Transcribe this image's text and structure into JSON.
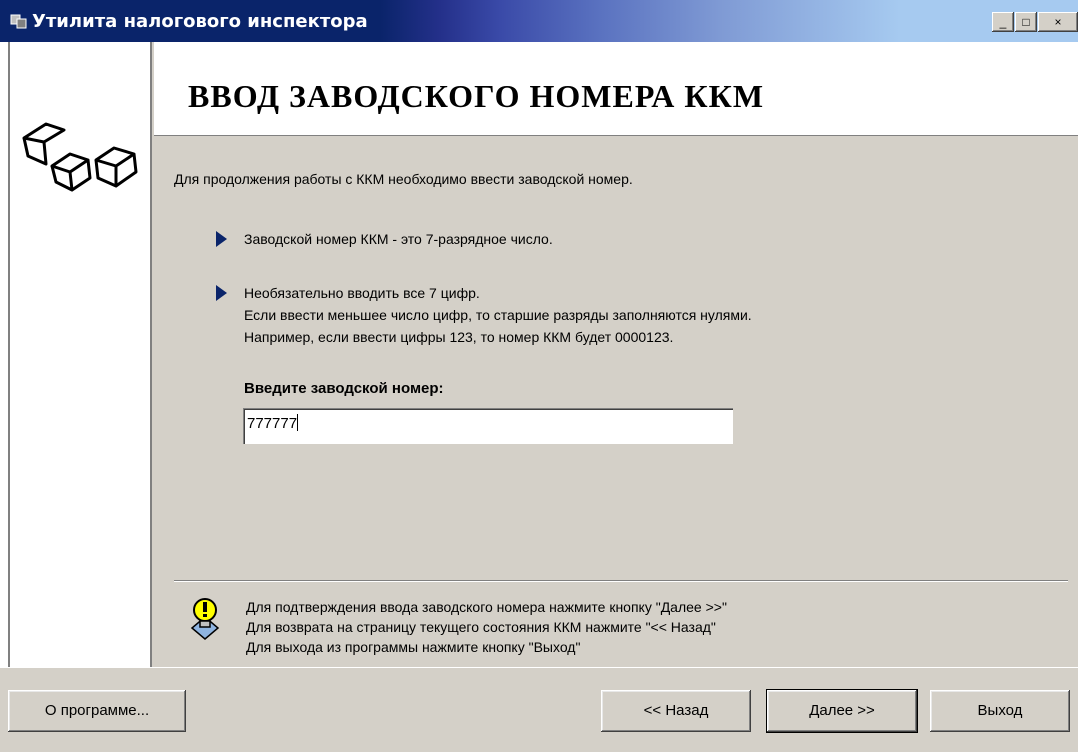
{
  "window": {
    "title": "Утилита налогового инспектора",
    "controls": {
      "minimize": "_",
      "maximize": "□",
      "close": "×"
    }
  },
  "header": {
    "title": "ВВОД ЗАВОДСКОГО НОМЕРА ККМ"
  },
  "content": {
    "intro": "Для продолжения работы с ККМ необходимо ввести заводской номер.",
    "bullets": [
      {
        "lines": [
          "Заводской номер ККМ - это 7-разрядное число."
        ]
      },
      {
        "lines": [
          "Необязательно вводить все 7 цифр.",
          "Если ввести меньшее число цифр, то старшие разряды заполняются нулями.",
          "Например, если ввести цифры 123, то номер ККМ будет 0000123."
        ]
      }
    ],
    "field_label": "Введите заводской номер:",
    "field_value": "777777"
  },
  "hints": [
    "Для подтверждения ввода заводского номера нажмите кнопку \"Далее >>\"",
    "Для возврата на страницу текущего состояния ККМ нажмите \"<< Назад\"",
    "Для выхода из программы нажмите кнопку \"Выход\""
  ],
  "buttons": {
    "about": "О программе...",
    "back": "<< Назад",
    "next": "Далее >>",
    "exit": "Выход"
  },
  "colors": {
    "title_bar": "#0a246a",
    "bullet": "#0a246a",
    "face": "#d4d0c8"
  },
  "icons": {
    "app": "app-icon",
    "logo": "cube-logo",
    "hint": "lightbulb-hint-icon",
    "bullet": "triangle-right-icon"
  }
}
